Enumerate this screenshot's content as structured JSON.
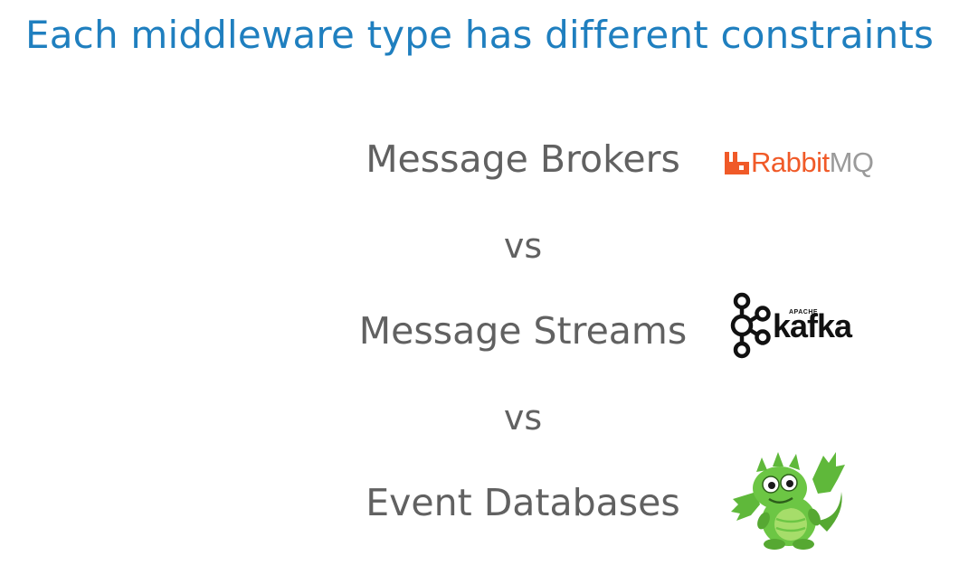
{
  "slide": {
    "title": "Each middleware type has different constraints"
  },
  "comparison": {
    "items": [
      {
        "label": "Message Brokers",
        "logo": {
          "icon": "rabbitmq-logo",
          "wordmark_primary": "Rabbit",
          "wordmark_secondary": "MQ"
        }
      },
      {
        "label": "Message Streams",
        "logo": {
          "icon": "kafka-logo",
          "overline": "APACHE",
          "wordmark": "kafka"
        }
      },
      {
        "label": "Event Databases",
        "logo": {
          "icon": "dragon-mascot-logo"
        }
      }
    ],
    "separator": "vs"
  },
  "colors": {
    "title": "#1f7fbf",
    "body_text": "#616161",
    "rabbitmq_orange": "#f05a28",
    "rabbitmq_gray": "#9a9a9a",
    "kafka_black": "#111111",
    "dragon_green": "#6cc644"
  }
}
